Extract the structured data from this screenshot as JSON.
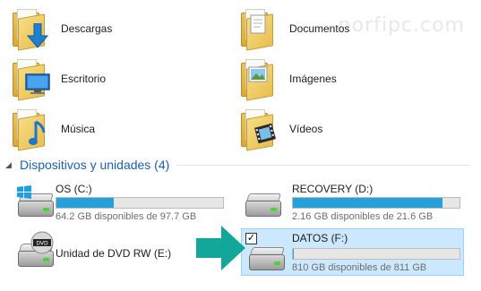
{
  "watermark": "norfipc.com",
  "folders": [
    {
      "label": "Descargas",
      "icon": "download-arrow-icon"
    },
    {
      "label": "Documentos",
      "icon": "document-icon"
    },
    {
      "label": "Escritorio",
      "icon": "desktop-screen-icon"
    },
    {
      "label": "Imágenes",
      "icon": "picture-icon"
    },
    {
      "label": "Música",
      "icon": "music-note-icon"
    },
    {
      "label": "Vídeos",
      "icon": "film-strip-icon"
    }
  ],
  "section": {
    "title": "Dispositivos y unidades (4)",
    "chevron": "◢"
  },
  "drives": [
    {
      "name": "OS (C:)",
      "free": "64.2 GB disponibles de 97.7 GB",
      "usage": 0.343
    },
    {
      "name": "RECOVERY (D:)",
      "free": "2.16 GB disponibles de 21.6 GB",
      "usage": 0.9
    },
    {
      "name": "Unidad de DVD RW (E:)"
    },
    {
      "name": "DATOS (F:)",
      "free": "810 GB disponibles de 811 GB",
      "usage": 0.001,
      "selected": true,
      "checked": "✓"
    }
  ],
  "colors": {
    "bar_fill": "#26a0da",
    "section_title": "#1e5eb0",
    "selection": "#cce8ff",
    "arrow": "#13a79a"
  }
}
